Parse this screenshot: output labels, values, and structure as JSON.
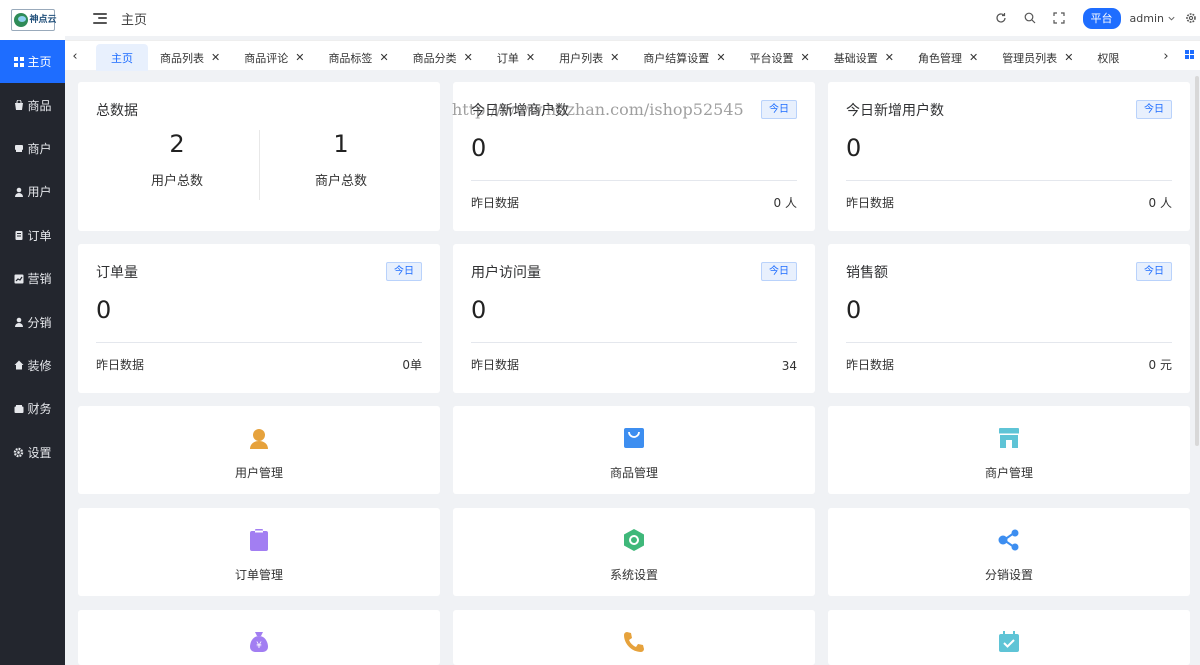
{
  "logo": {
    "text": "神点云"
  },
  "sidebar": {
    "items": [
      {
        "label": "主页",
        "icon": "dashboard-icon"
      },
      {
        "label": "商品",
        "icon": "bag-icon"
      },
      {
        "label": "商户",
        "icon": "store-icon"
      },
      {
        "label": "用户",
        "icon": "user-icon"
      },
      {
        "label": "订单",
        "icon": "order-icon"
      },
      {
        "label": "营销",
        "icon": "chart-icon"
      },
      {
        "label": "分销",
        "icon": "distribution-icon"
      },
      {
        "label": "装修",
        "icon": "home-icon"
      },
      {
        "label": "财务",
        "icon": "wallet-icon"
      },
      {
        "label": "设置",
        "icon": "gear-icon"
      }
    ]
  },
  "header": {
    "title": "主页",
    "platform_label": "平台",
    "user_name": "admin"
  },
  "tabs": [
    {
      "label": "主页",
      "closable": false
    },
    {
      "label": "商品列表",
      "closable": true
    },
    {
      "label": "商品评论",
      "closable": true
    },
    {
      "label": "商品标签",
      "closable": true
    },
    {
      "label": "商品分类",
      "closable": true
    },
    {
      "label": "订单",
      "closable": true
    },
    {
      "label": "用户列表",
      "closable": true
    },
    {
      "label": "商户结算设置",
      "closable": true
    },
    {
      "label": "平台设置",
      "closable": true
    },
    {
      "label": "基础设置",
      "closable": true
    },
    {
      "label": "角色管理",
      "closable": true
    },
    {
      "label": "管理员列表",
      "closable": true
    },
    {
      "label": "权限",
      "closable": false
    }
  ],
  "total": {
    "title": "总数据",
    "users": {
      "value": "2",
      "label": "用户总数"
    },
    "merchants": {
      "value": "1",
      "label": "商户总数"
    }
  },
  "stats": [
    {
      "title": "今日新增商户数",
      "badge": "今日",
      "value": "0",
      "yesterday_label": "昨日数据",
      "yesterday_value": "0 人"
    },
    {
      "title": "今日新增用户数",
      "badge": "今日",
      "value": "0",
      "yesterday_label": "昨日数据",
      "yesterday_value": "0 人"
    },
    {
      "title": "订单量",
      "badge": "今日",
      "value": "0",
      "yesterday_label": "昨日数据",
      "yesterday_value": "0单"
    },
    {
      "title": "用户访问量",
      "badge": "今日",
      "value": "0",
      "yesterday_label": "昨日数据",
      "yesterday_value": "34"
    },
    {
      "title": "销售额",
      "badge": "今日",
      "value": "0",
      "yesterday_label": "昨日数据",
      "yesterday_value": "0 元"
    }
  ],
  "quick": [
    {
      "label": "用户管理",
      "icon": "user-manage-icon",
      "color": "#e6a23c"
    },
    {
      "label": "商品管理",
      "icon": "shopping-bag-icon",
      "color": "#3d8ef0"
    },
    {
      "label": "商户管理",
      "icon": "storefront-icon",
      "color": "#5fc4d6"
    },
    {
      "label": "订单管理",
      "icon": "clipboard-icon",
      "color": "#a27ef2"
    },
    {
      "label": "系统设置",
      "icon": "hexagon-settings-icon",
      "color": "#3fb87a"
    },
    {
      "label": "分销设置",
      "icon": "share-icon",
      "color": "#3d8ef0"
    },
    {
      "label": "",
      "icon": "money-bag-icon",
      "color": "#a27ef2"
    },
    {
      "label": "",
      "icon": "phone-icon",
      "color": "#e6a23c"
    },
    {
      "label": "",
      "icon": "calendar-check-icon",
      "color": "#5fc4d6"
    }
  ],
  "watermark": "http://www.huzhan.com/ishop52545",
  "colors": {
    "primary": "#1e6dff",
    "sidebar_bg": "#23262e",
    "page_bg": "#f0f2f5"
  }
}
